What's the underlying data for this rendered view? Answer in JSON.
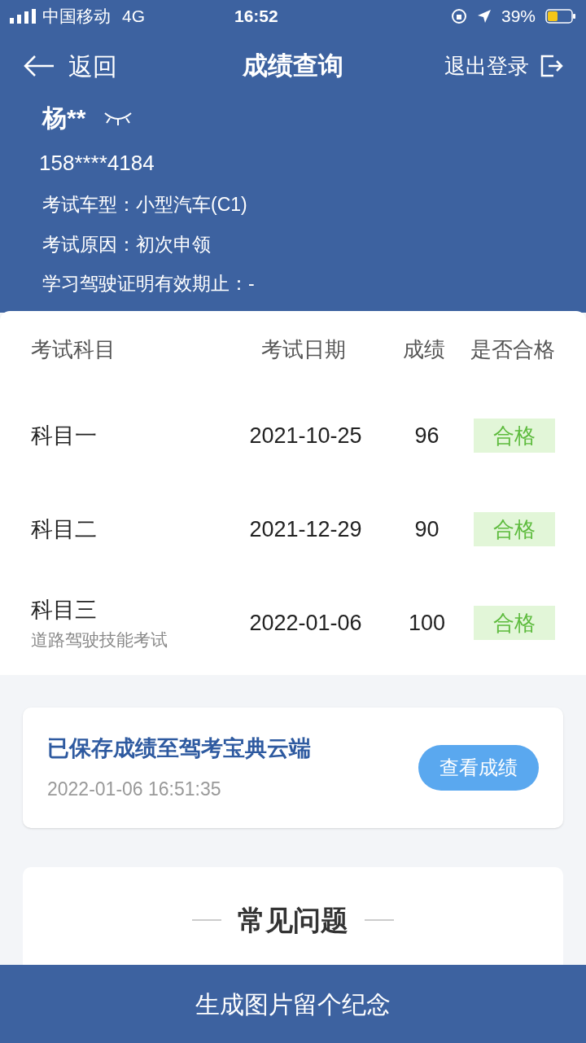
{
  "status_bar": {
    "carrier": "中国移动",
    "network": "4G",
    "time": "16:52",
    "battery": "39%"
  },
  "nav": {
    "back": "返回",
    "title": "成绩查询",
    "logout": "退出登录"
  },
  "profile": {
    "name": "杨**",
    "phone": "158****4184",
    "lines": [
      "考试车型：小型汽车(C1)",
      "考试原因：初次申领",
      "学习驾驶证明有效期止：-"
    ]
  },
  "table": {
    "columns": [
      "考试科目",
      "考试日期",
      "成绩",
      "是否合格"
    ],
    "rows": [
      {
        "subject": "科目一",
        "date": "2021-10-25",
        "score": "96",
        "result": "合格",
        "passed": true
      },
      {
        "subject": "科目二",
        "date": "2021-12-29",
        "score": "90",
        "result": "合格",
        "passed": true
      },
      {
        "subject": "科目三",
        "note": "道路驾驶技能考试",
        "date": "2022-01-06",
        "score": "100",
        "result": "合格",
        "passed": true
      }
    ]
  },
  "saved_card": {
    "title": "已保存成绩至驾考宝典云端",
    "time": "2022-01-06 16:51:35",
    "button": "查看成绩"
  },
  "faq": {
    "title": "常见问题"
  },
  "bottom_button": "生成图片留个纪念"
}
